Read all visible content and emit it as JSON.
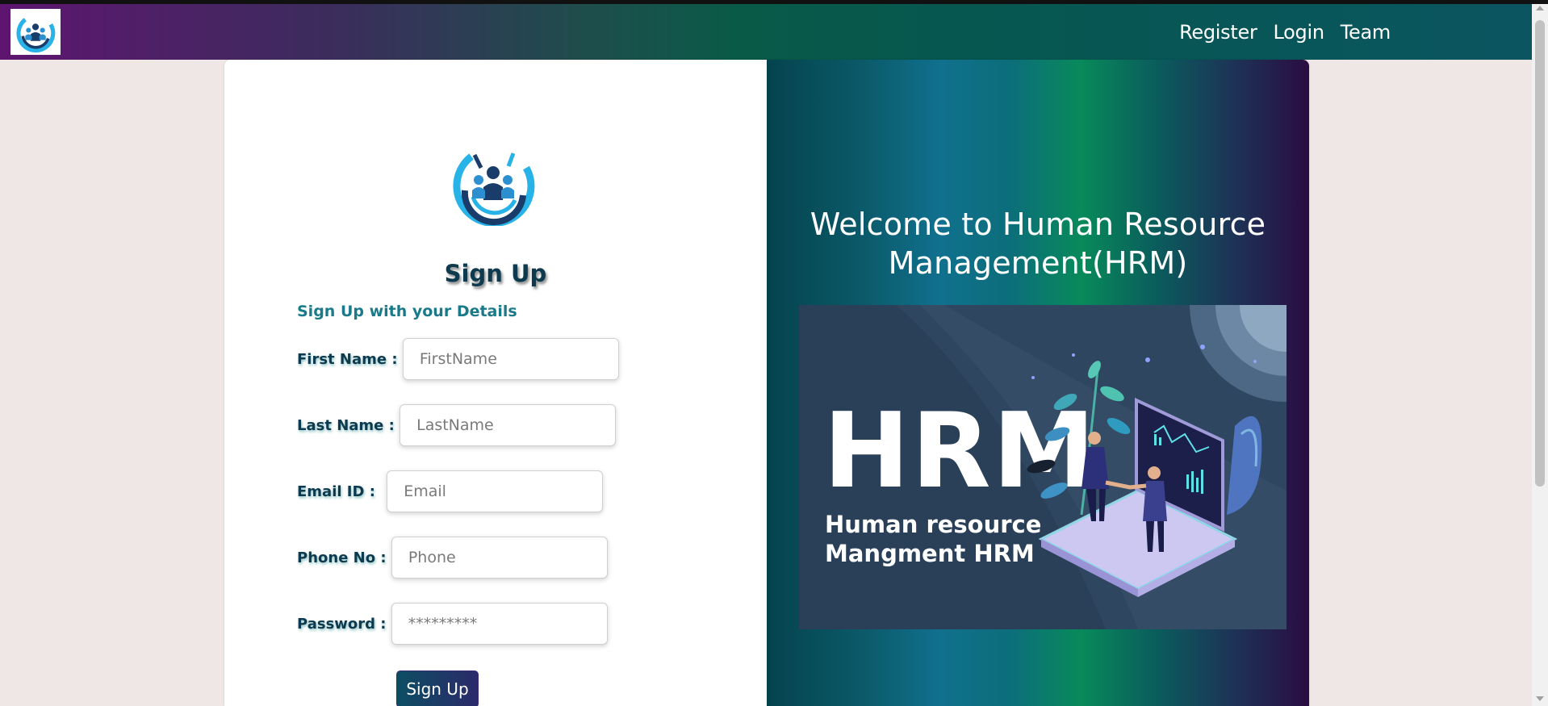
{
  "nav": {
    "links": [
      {
        "label": "Register"
      },
      {
        "label": "Login"
      },
      {
        "label": "Team"
      }
    ]
  },
  "form": {
    "title": "Sign Up",
    "subtitle": "Sign Up with your Details",
    "fields": [
      {
        "label": "First Name : ",
        "placeholder": "FirstName"
      },
      {
        "label": "Last Name : ",
        "placeholder": "LastName"
      },
      {
        "label": "Email ID : ",
        "placeholder": "Email"
      },
      {
        "label": "Phone No : ",
        "placeholder": "Phone"
      },
      {
        "label": "Password : ",
        "placeholder": "*********"
      }
    ],
    "submit_label": "Sign Up"
  },
  "hero": {
    "heading": "Welcome to Human Resource Management(HRM)",
    "image_title": "HRM",
    "image_subtitle_line1": "Human resource",
    "image_subtitle_line2": "Mangment HRM"
  },
  "colors": {
    "brand_dark": "#0d3a4f",
    "accent_teal": "#1a7a8a",
    "nav_purple": "#5e1570",
    "nav_green": "#06574f"
  },
  "icons": [
    "people-logo-icon",
    "team-logo-icon"
  ]
}
